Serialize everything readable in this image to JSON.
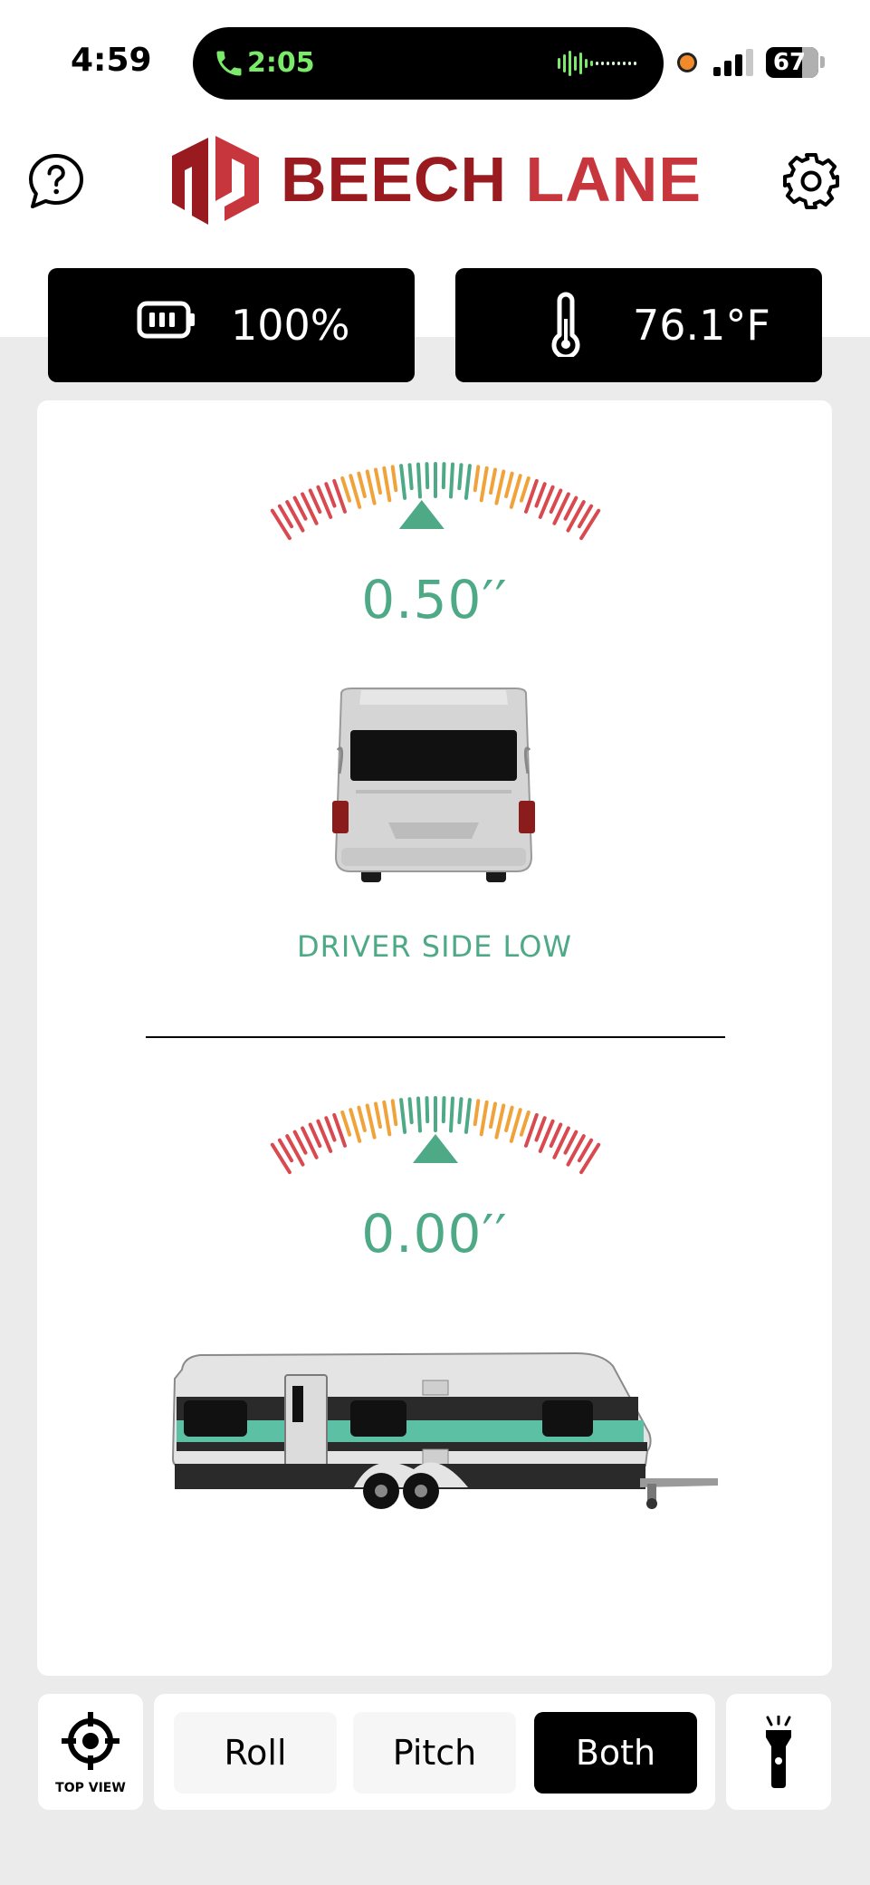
{
  "status_bar": {
    "time": "4:59",
    "call_duration": "2:05",
    "battery_level": "67",
    "call_icon": "phone-icon",
    "wave_icon": "audio-wave-icon",
    "signal_icon": "cellular-signal-icon"
  },
  "header": {
    "help_icon": "help-icon",
    "brand_word1": "BEECH",
    "brand_word2": "LANE",
    "settings_icon": "gear-icon"
  },
  "stats": {
    "battery": {
      "icon": "battery-icon",
      "value": "100%"
    },
    "temperature": {
      "icon": "thermometer-icon",
      "value": "76.1°F"
    }
  },
  "roll": {
    "reading": "0.50′′",
    "status": "DRIVER SIDE LOW",
    "indicator_fraction": 0.46,
    "image": "trailer-rear-view"
  },
  "pitch": {
    "reading": "0.00′′",
    "indicator_fraction": 0.5,
    "image": "trailer-side-view"
  },
  "bottom_bar": {
    "top_view_label": "TOP VIEW",
    "top_view_icon": "crosshair-icon",
    "modes": [
      "Roll",
      "Pitch",
      "Both"
    ],
    "selected_mode": "Both",
    "flashlight_icon": "flashlight-icon"
  },
  "colors": {
    "green": "#4ea987",
    "orange": "#f0a33a",
    "red": "#d84a4f",
    "brand_dark_red": "#9a1b1f",
    "brand_red": "#c8363d"
  }
}
